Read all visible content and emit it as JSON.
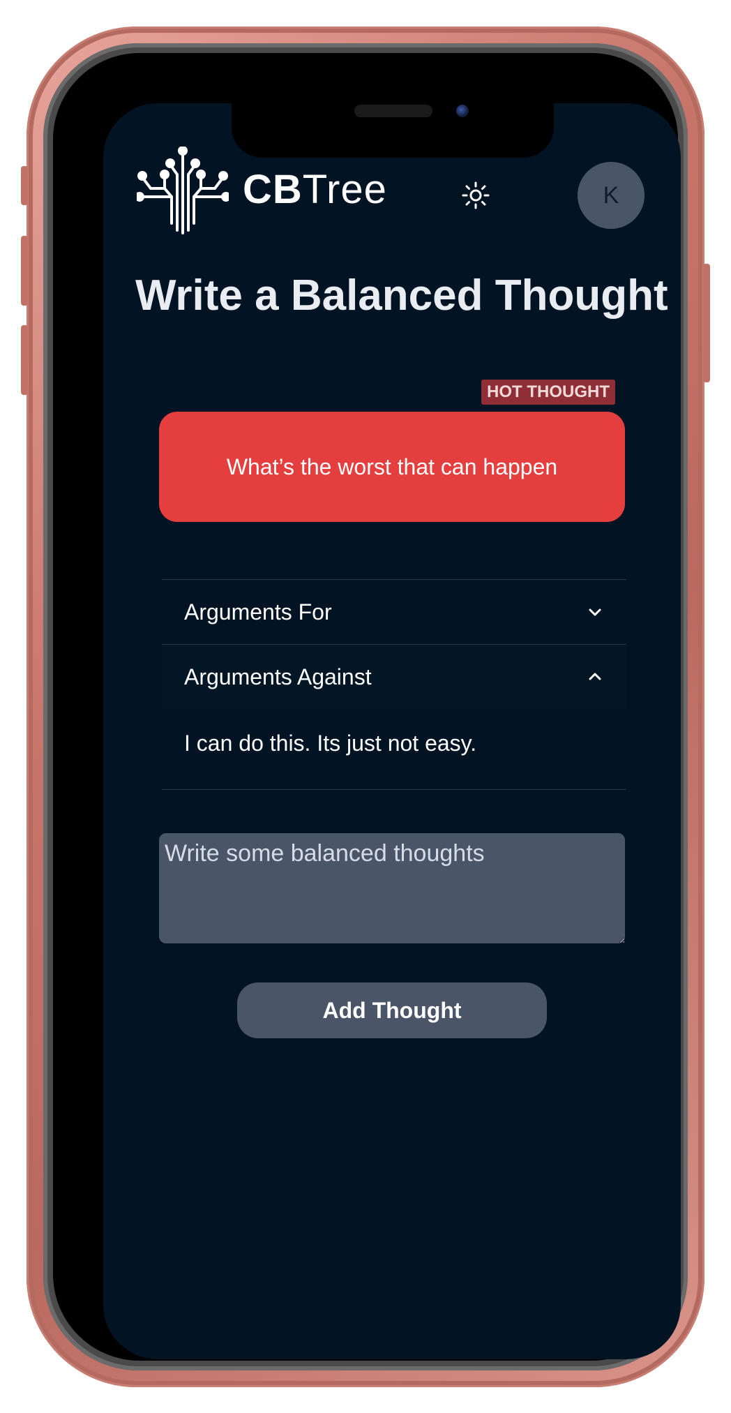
{
  "app": {
    "logo_bold": "CB",
    "logo_light": "Tree",
    "avatar_initial": "K"
  },
  "page": {
    "title": "Write a Balanced Thought"
  },
  "hot_thought": {
    "badge": "HOT THOUGHT",
    "text": "What’s the worst that can happen"
  },
  "accordion": {
    "items": [
      {
        "label": "Arguments For",
        "expanded": false
      },
      {
        "label": "Arguments Against",
        "expanded": true,
        "content": "I can do this. Its just not easy."
      }
    ]
  },
  "input": {
    "placeholder": "Write some balanced thoughts",
    "value": ""
  },
  "actions": {
    "add_label": "Add Thought"
  },
  "colors": {
    "background": "#021323",
    "hot_thought": "#e53e3e",
    "badge": "#8f2f35",
    "control": "#4a5568",
    "frame": "#c8766b"
  },
  "icons": {
    "logo": "tree-logo-icon",
    "theme": "sun-icon",
    "collapsed": "chevron-down-icon",
    "expanded": "chevron-up-icon"
  }
}
